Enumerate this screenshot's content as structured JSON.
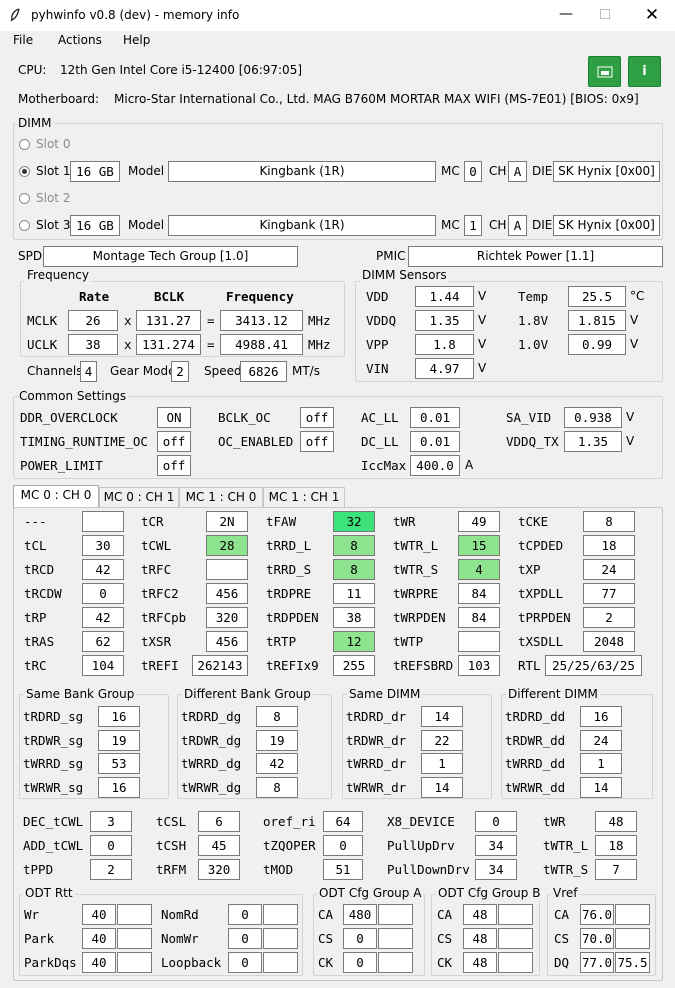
{
  "window": {
    "title": "pyhwinfo v0.8 (dev) - memory info",
    "icon": "feather-icon"
  },
  "menu": [
    "File",
    "Actions",
    "Help"
  ],
  "cpu": {
    "label": "CPU:",
    "value": "12th Gen Intel Core i5-12400  [06:97:05]"
  },
  "mb": {
    "label": "Motherboard:",
    "value": "Micro-Star International Co., Ltd. MAG B760M MORTAR MAX WIFI (MS-7E01)  [BIOS: 0x9]"
  },
  "buttons": {
    "save_icon": "save-icon",
    "info_icon": "i",
    "accent": "#2ea043"
  },
  "dimm": {
    "title": "DIMM",
    "slots": [
      {
        "label": "Slot 0"
      },
      {
        "label": "Slot 1",
        "size": "16 GB",
        "model_label": "Model",
        "model": "Kingbank     (1R)",
        "mc_label": "MC",
        "mc": "0",
        "ch_label": "CH",
        "ch": "A",
        "die_label": "DIE",
        "die": "SK Hynix [0x00]"
      },
      {
        "label": "Slot 2"
      },
      {
        "label": "Slot 3",
        "size": "16 GB",
        "model_label": "Model",
        "model": "Kingbank     (1R)",
        "mc_label": "MC",
        "mc": "1",
        "ch_label": "CH",
        "ch": "A",
        "die_label": "DIE",
        "die": "SK Hynix [0x00]"
      }
    ]
  },
  "spd": {
    "label": "SPD",
    "value": "Montage Tech Group [1.0]"
  },
  "pmic": {
    "label": "PMIC",
    "value": "Richtek Power [1.1]"
  },
  "freq": {
    "title": "Frequency",
    "h_rate": "Rate",
    "h_bclk": "BCLK",
    "h_freq": "Frequency",
    "mclk": {
      "label": "MCLK",
      "rate": "26",
      "bclk": "131.27",
      "freq": "3413.12",
      "unit": "MHz"
    },
    "uclk": {
      "label": "UCLK",
      "rate": "38",
      "bclk": "131.274",
      "freq": "4988.41",
      "unit": "MHz"
    },
    "x": "x",
    "eq": "="
  },
  "chan": {
    "label": "Channels",
    "value": "4",
    "gear_label": "Gear Mode",
    "gear": "2",
    "speed_label": "Speed",
    "speed": "6826",
    "speed_unit": "MT/s"
  },
  "sensors": {
    "title": "DIMM Sensors",
    "vdd": {
      "label": "VDD",
      "value": "1.44",
      "unit": "V"
    },
    "vddq": {
      "label": "VDDQ",
      "value": "1.35",
      "unit": "V"
    },
    "vpp": {
      "label": "VPP",
      "value": "1.8",
      "unit": "V"
    },
    "vin": {
      "label": "VIN",
      "value": "4.97",
      "unit": "V"
    },
    "temp": {
      "label": "Temp",
      "value": "25.5",
      "unit": "°C"
    },
    "v18": {
      "label": "1.8V",
      "value": "1.815",
      "unit": "V"
    },
    "v10": {
      "label": "1.0V",
      "value": "0.99",
      "unit": "V"
    }
  },
  "common": {
    "title": "Common Settings",
    "ddr_oc": {
      "label": "DDR_OVERCLOCK",
      "value": "ON"
    },
    "timing_rt": {
      "label": "TIMING_RUNTIME_OC",
      "value": "off"
    },
    "power_limit": {
      "label": "POWER_LIMIT",
      "value": "off"
    },
    "bclk_oc": {
      "label": "BCLK_OC",
      "value": "off"
    },
    "oc_en": {
      "label": "OC_ENABLED",
      "value": "off"
    },
    "ac_ll": {
      "label": "AC_LL",
      "value": "0.01"
    },
    "dc_ll": {
      "label": "DC_LL",
      "value": "0.01"
    },
    "iccmax": {
      "label": "IccMax",
      "value": "400.0",
      "unit": "A"
    },
    "sa_vid": {
      "label": "SA_VID",
      "value": "0.938",
      "unit": "V"
    },
    "vddq_tx": {
      "label": "VDDQ_TX",
      "value": "1.35",
      "unit": "V"
    }
  },
  "tabs": [
    "MC 0 : CH 0",
    "MC 0 : CH 1",
    "MC 1 : CH 0",
    "MC 1 : CH 1"
  ],
  "timings": [
    [
      [
        "---",
        ""
      ],
      [
        "tCR",
        "2N"
      ],
      [
        "tFAW",
        "32"
      ],
      [
        "tWR",
        "49"
      ],
      [
        "tCKE",
        "8"
      ]
    ],
    [
      [
        "tCL",
        "30"
      ],
      [
        "tCWL",
        "28"
      ],
      [
        "tRRD_L",
        "8"
      ],
      [
        "tWTR_L",
        "15"
      ],
      [
        "tCPDED",
        "18"
      ]
    ],
    [
      [
        "tRCD",
        "42"
      ],
      [
        "tRFC",
        ""
      ],
      [
        "tRRD_S",
        "8"
      ],
      [
        "tWTR_S",
        "4"
      ],
      [
        "tXP",
        "24"
      ]
    ],
    [
      [
        "tRCDW",
        "0"
      ],
      [
        "tRFC2",
        "456"
      ],
      [
        "tRDPRE",
        "11"
      ],
      [
        "tWRPRE",
        "84"
      ],
      [
        "tXPDLL",
        "77"
      ]
    ],
    [
      [
        "tRP",
        "42"
      ],
      [
        "tRFCpb",
        "320"
      ],
      [
        "tRDPDEN",
        "38"
      ],
      [
        "tWRPDEN",
        "84"
      ],
      [
        "tPRPDEN",
        "2"
      ]
    ],
    [
      [
        "tRAS",
        "62"
      ],
      [
        "tXSR",
        "456"
      ],
      [
        "tRTP",
        "12"
      ],
      [
        "tWTP",
        ""
      ],
      [
        "tXSDLL",
        "2048"
      ]
    ],
    [
      [
        "tRC",
        "104"
      ],
      [
        "tREFI",
        "262143"
      ],
      [
        "tREFIx9",
        "255"
      ],
      [
        "tREFSBRD",
        "103"
      ],
      [
        "RTL",
        "25/25/63/25"
      ]
    ]
  ],
  "groups": [
    {
      "title": "Same Bank Group",
      "rows": [
        [
          "tRDRD_sg",
          "16"
        ],
        [
          "tRDWR_sg",
          "19"
        ],
        [
          "tWRRD_sg",
          "53"
        ],
        [
          "tWRWR_sg",
          "16"
        ]
      ]
    },
    {
      "title": "Different Bank Group",
      "rows": [
        [
          "tRDRD_dg",
          "8"
        ],
        [
          "tRDWR_dg",
          "19"
        ],
        [
          "tWRRD_dg",
          "42"
        ],
        [
          "tWRWR_dg",
          "8"
        ]
      ]
    },
    {
      "title": "Same DIMM",
      "rows": [
        [
          "tRDRD_dr",
          "14"
        ],
        [
          "tRDWR_dr",
          "22"
        ],
        [
          "tWRRD_dr",
          "1"
        ],
        [
          "tWRWR_dr",
          "14"
        ]
      ]
    },
    {
      "title": "Different DIMM",
      "rows": [
        [
          "tRDRD_dd",
          "16"
        ],
        [
          "tRDWR_dd",
          "24"
        ],
        [
          "tWRRD_dd",
          "1"
        ],
        [
          "tWRWR_dd",
          "14"
        ]
      ]
    }
  ],
  "misc": [
    [
      [
        "DEC_tCWL",
        "3"
      ],
      [
        "tCSL",
        "6"
      ],
      [
        "oref_ri",
        "64"
      ],
      [
        "X8_DEVICE",
        "0"
      ],
      [
        "tWR",
        "48"
      ]
    ],
    [
      [
        "ADD_tCWL",
        "0"
      ],
      [
        "tCSH",
        "45"
      ],
      [
        "tZQOPER",
        "0"
      ],
      [
        "PullUpDrv",
        "34"
      ],
      [
        "tWTR_L",
        "18"
      ]
    ],
    [
      [
        "tPPD",
        "2"
      ],
      [
        "tRFM",
        "320"
      ],
      [
        "tMOD",
        "51"
      ],
      [
        "PullDownDrv",
        "34"
      ],
      [
        "tWTR_S",
        "7"
      ]
    ]
  ],
  "odt": {
    "title": "ODT Rtt",
    "rows": [
      [
        "Wr",
        "40",
        "",
        "NomRd",
        "0",
        ""
      ],
      [
        "Park",
        "40",
        "",
        "NomWr",
        "0",
        ""
      ],
      [
        "ParkDqs",
        "40",
        "",
        "Loopback",
        "0",
        ""
      ]
    ]
  },
  "cfgA": {
    "title": "ODT Cfg Group A",
    "rows": [
      [
        "CA",
        "480",
        ""
      ],
      [
        "CS",
        "0",
        ""
      ],
      [
        "CK",
        "0",
        ""
      ]
    ]
  },
  "cfgB": {
    "title": "ODT Cfg Group B",
    "rows": [
      [
        "CA",
        "48",
        ""
      ],
      [
        "CS",
        "48",
        ""
      ],
      [
        "CK",
        "48",
        ""
      ]
    ]
  },
  "vref": {
    "title": "Vref",
    "rows": [
      [
        "CA",
        "76.0",
        ""
      ],
      [
        "CS",
        "70.0",
        ""
      ],
      [
        "DQ",
        "77.0",
        "75.5"
      ]
    ]
  }
}
